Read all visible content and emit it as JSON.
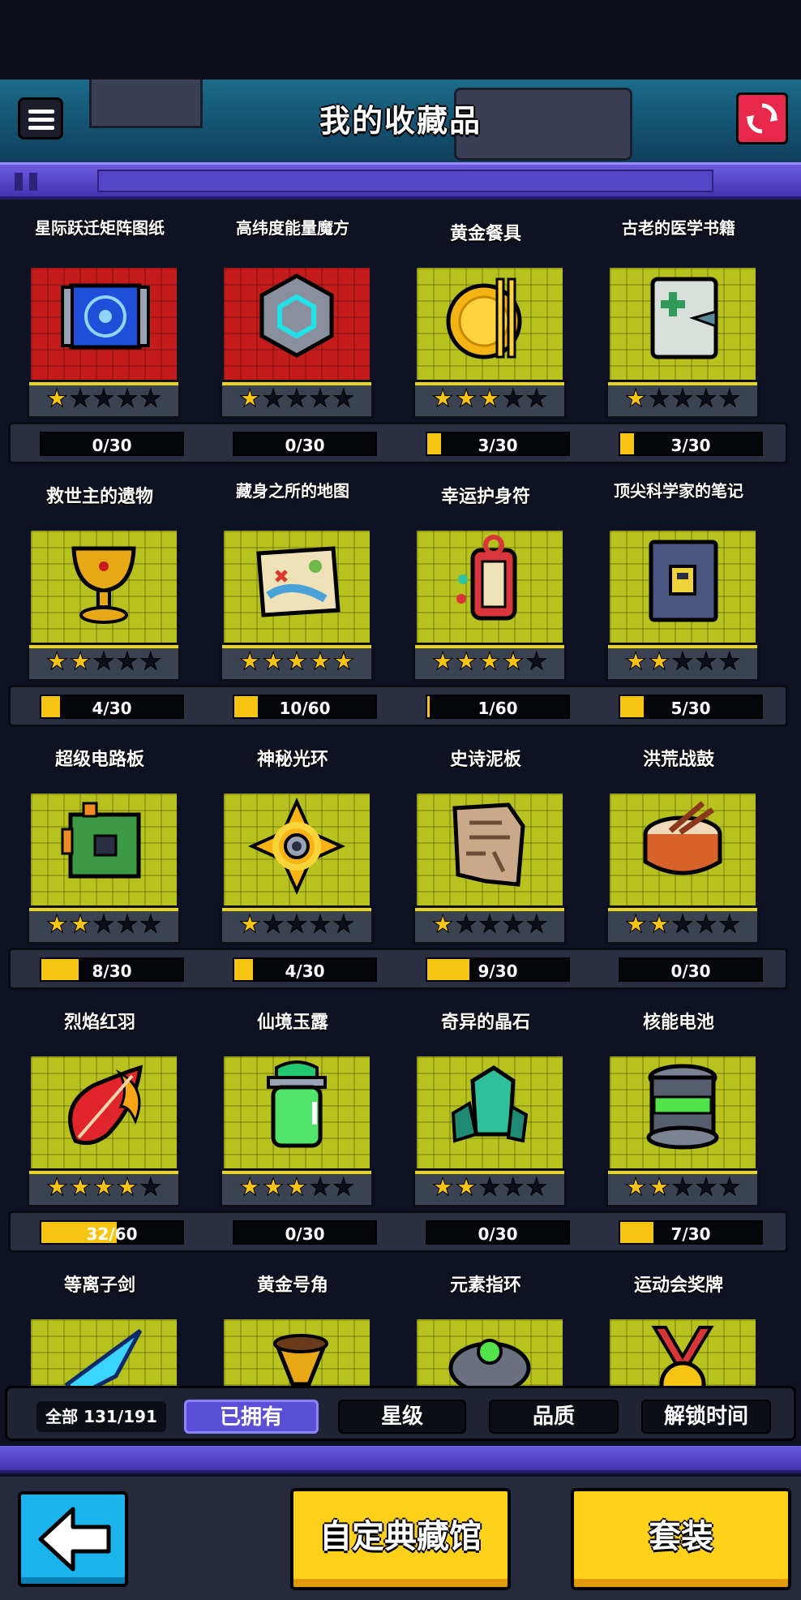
{
  "header": {
    "title": "我的收藏品"
  },
  "items": [
    {
      "name": "星际跃迁矩阵图纸",
      "stars": 1,
      "progress": "0/30",
      "fill": 0,
      "bg": "red",
      "icon": "blueprint-icon"
    },
    {
      "name": "高纬度能量魔方",
      "stars": 1,
      "progress": "0/30",
      "fill": 0,
      "bg": "red",
      "icon": "energy-cube-icon"
    },
    {
      "name": "黄金餐具",
      "stars": 3,
      "progress": "3/30",
      "fill": 0.1,
      "bg": "yellow",
      "icon": "golden-tableware-icon"
    },
    {
      "name": "古老的医学书籍",
      "stars": 1,
      "progress": "3/30",
      "fill": 0.1,
      "bg": "yellow",
      "icon": "medical-book-icon"
    },
    {
      "name": "救世主的遗物",
      "stars": 2,
      "progress": "4/30",
      "fill": 0.133,
      "bg": "yellow",
      "icon": "golden-chalice-icon"
    },
    {
      "name": "藏身之所的地图",
      "stars": 5,
      "progress": "10/60",
      "fill": 0.167,
      "bg": "yellow",
      "icon": "treasure-map-icon"
    },
    {
      "name": "幸运护身符",
      "stars": 4,
      "progress": "1/60",
      "fill": 0.017,
      "bg": "yellow",
      "icon": "lucky-charm-icon"
    },
    {
      "name": "顶尖科学家的笔记",
      "stars": 2,
      "progress": "5/30",
      "fill": 0.167,
      "bg": "yellow",
      "icon": "locked-notebook-icon"
    },
    {
      "name": "超级电路板",
      "stars": 2,
      "progress": "8/30",
      "fill": 0.267,
      "bg": "yellow",
      "icon": "circuit-board-icon"
    },
    {
      "name": "神秘光环",
      "stars": 1,
      "progress": "4/30",
      "fill": 0.133,
      "bg": "yellow",
      "icon": "mystic-halo-icon"
    },
    {
      "name": "史诗泥板",
      "stars": 1,
      "progress": "9/30",
      "fill": 0.3,
      "bg": "yellow",
      "icon": "clay-tablet-icon"
    },
    {
      "name": "洪荒战鼓",
      "stars": 2,
      "progress": "0/30",
      "fill": 0,
      "bg": "yellow",
      "icon": "war-drum-icon"
    },
    {
      "name": "烈焰红羽",
      "stars": 4,
      "progress": "32/60",
      "fill": 0.533,
      "bg": "yellow",
      "icon": "flame-feather-icon"
    },
    {
      "name": "仙境玉露",
      "stars": 3,
      "progress": "0/30",
      "fill": 0,
      "bg": "yellow",
      "icon": "jade-dew-jar-icon"
    },
    {
      "name": "奇异的晶石",
      "stars": 2,
      "progress": "0/30",
      "fill": 0,
      "bg": "yellow",
      "icon": "crystal-icon"
    },
    {
      "name": "核能电池",
      "stars": 2,
      "progress": "7/30",
      "fill": 0.233,
      "bg": "yellow",
      "icon": "nuclear-battery-icon"
    },
    {
      "name": "等离子剑",
      "icon": "plasma-sword-icon",
      "bg": "yellow"
    },
    {
      "name": "黄金号角",
      "icon": "golden-horn-icon",
      "bg": "yellow"
    },
    {
      "name": "元素指环",
      "icon": "element-ring-icon",
      "bg": "yellow"
    },
    {
      "name": "运动会奖牌",
      "icon": "sports-medal-icon",
      "bg": "yellow"
    }
  ],
  "filter": {
    "total": "全部 131/191",
    "owned": "已拥有",
    "stars": "星级",
    "quality": "品质",
    "unlock_time": "解锁时间"
  },
  "bottom": {
    "custom_museum": "自定典藏馆",
    "outfit": "套装"
  },
  "colors": {
    "accent_yellow": "#f8c414",
    "purple": "#5a4fd6",
    "red_bg": "#c41b1b",
    "yellow_bg": "#b8c21f"
  }
}
